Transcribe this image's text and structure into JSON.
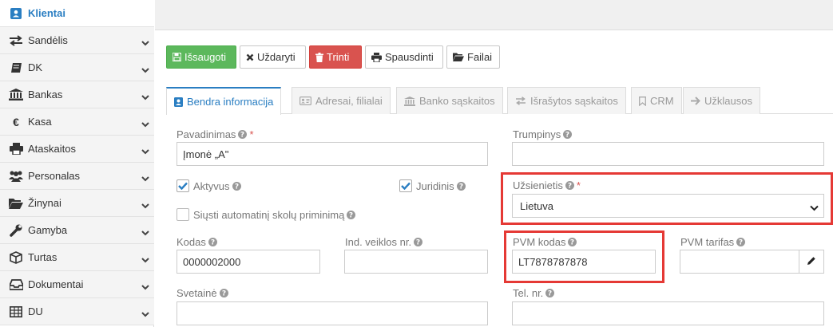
{
  "sidebar": {
    "items": [
      {
        "label": "Klientai",
        "icon": "client-icon",
        "active": true
      },
      {
        "label": "Sandėlis",
        "icon": "exchange-icon"
      },
      {
        "label": "DK",
        "icon": "book-icon"
      },
      {
        "label": "Bankas",
        "icon": "bank-icon"
      },
      {
        "label": "Kasa",
        "icon": "euro-icon"
      },
      {
        "label": "Ataskaitos",
        "icon": "printer-icon"
      },
      {
        "label": "Personalas",
        "icon": "users-icon"
      },
      {
        "label": "Žinynai",
        "icon": "folder-open-icon"
      },
      {
        "label": "Gamyba",
        "icon": "wrench-icon"
      },
      {
        "label": "Turtas",
        "icon": "cube-icon"
      },
      {
        "label": "Dokumentai",
        "icon": "inbox-icon"
      },
      {
        "label": "DU",
        "icon": "table-icon"
      }
    ]
  },
  "toolbar": {
    "save": "Išsaugoti",
    "close": "Uždaryti",
    "delete": "Trinti",
    "print": "Spausdinti",
    "files": "Failai"
  },
  "tabs": [
    {
      "label": "Bendra informacija",
      "icon": "client-icon",
      "active": true
    },
    {
      "label": "Adresai, filialai",
      "icon": "address-card-icon"
    },
    {
      "label": "Banko sąskaitos",
      "icon": "bank-icon"
    },
    {
      "label": "Išrašytos sąskaitos",
      "icon": "exchange-icon"
    },
    {
      "label": "CRM",
      "icon": "bookmark-icon"
    },
    {
      "label": "Užklausos",
      "icon": "arrow-right-icon"
    }
  ],
  "form": {
    "name_label": "Pavadinimas",
    "name_value": "Įmonė „A\"",
    "short_label": "Trumpinys",
    "short_value": "",
    "active_label": "Aktyvus",
    "juridical_label": "Juridinis",
    "reminder_label": "Siųsti automatinį skolų priminimą",
    "foreign_label": "Užsienietis",
    "foreign_value": "Lietuva",
    "code_label": "Kodas",
    "code_value": "0000002000",
    "activity_label": "Ind. veiklos nr.",
    "activity_value": "",
    "vat_code_label": "PVM kodas",
    "vat_code_value": "LT7878787878",
    "vat_rate_label": "PVM tarifas",
    "vat_rate_value": "",
    "website_label": "Svetainė",
    "phone_label": "Tel. nr."
  },
  "colors": {
    "accent": "#2a7ec2",
    "save": "#5cb85c",
    "delete": "#d9534f",
    "highlight": "#e53935"
  }
}
